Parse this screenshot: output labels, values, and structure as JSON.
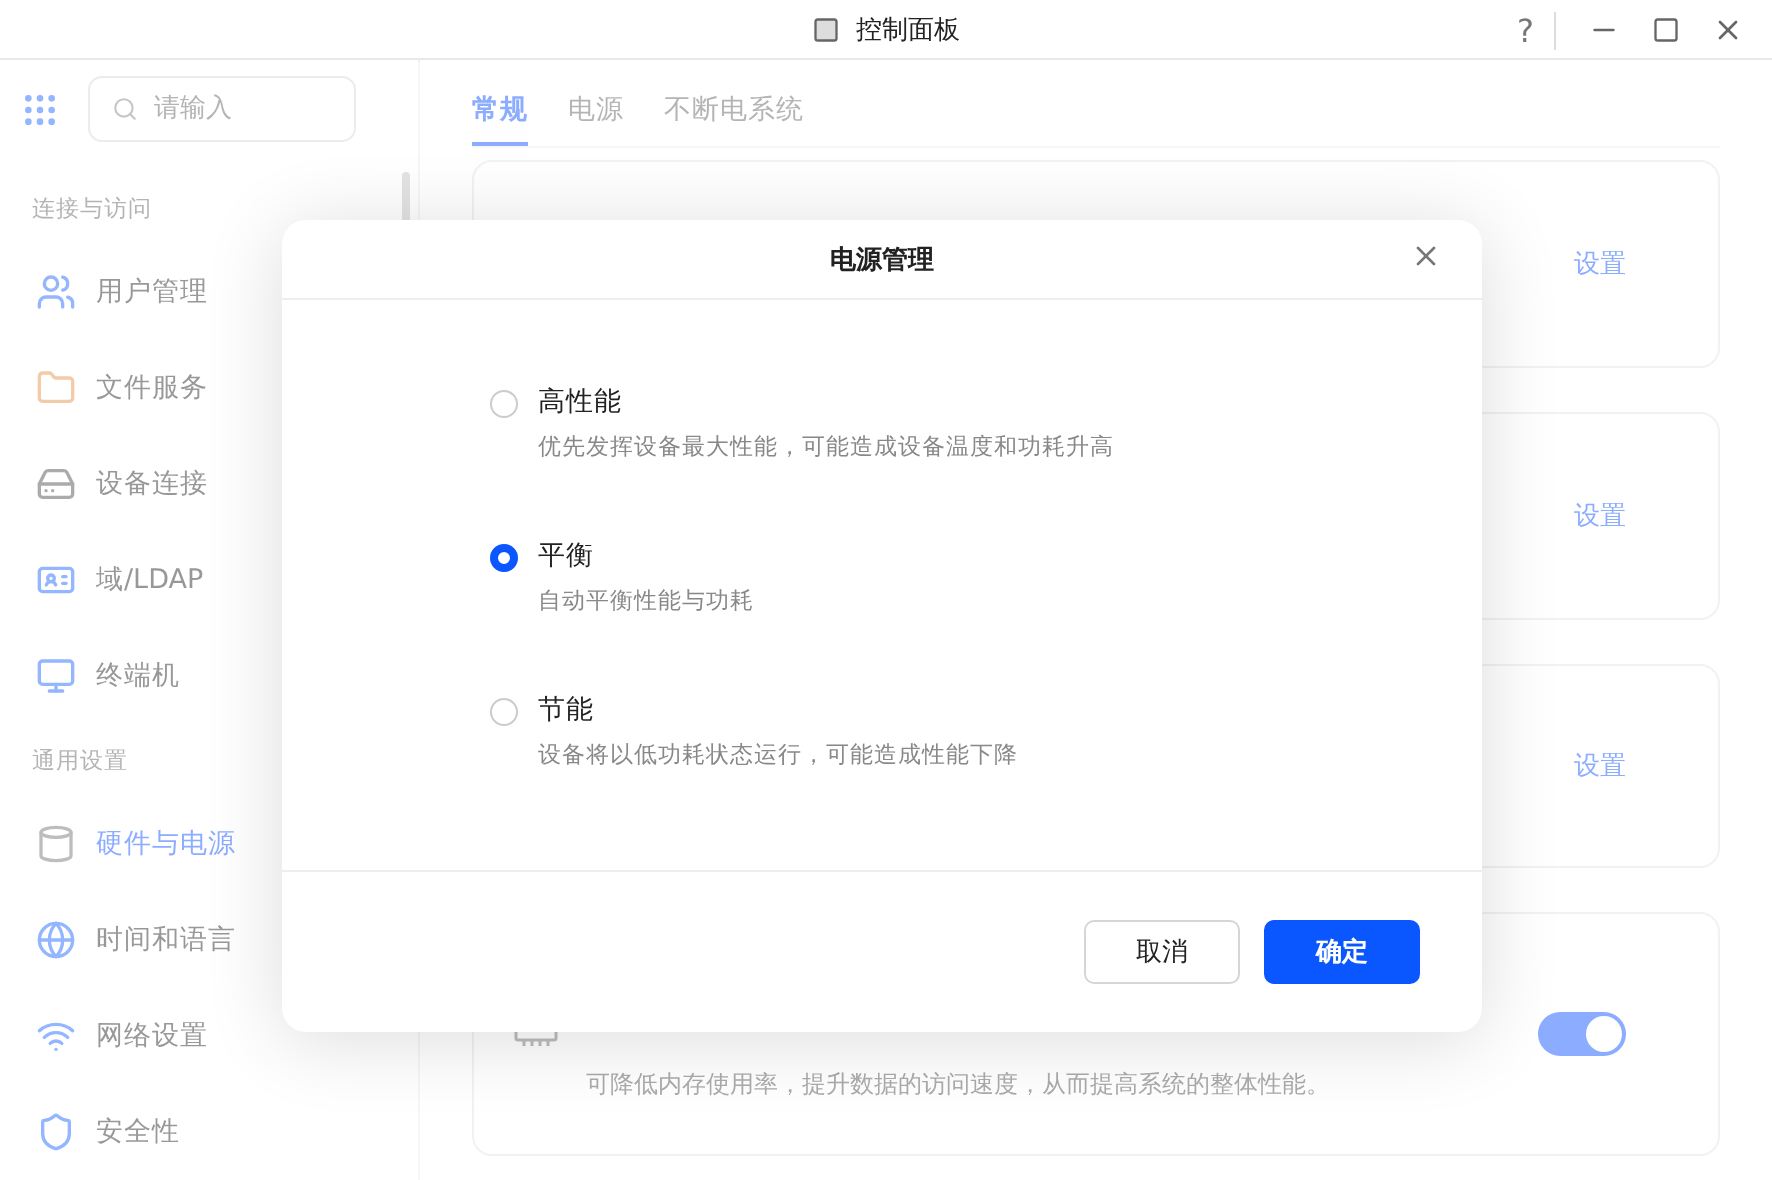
{
  "window": {
    "title": "控制面板",
    "buttons": [
      "?"
    ]
  },
  "sidebar": {
    "search": {
      "placeholder": "请输入"
    },
    "sections": [
      {
        "title": "连接与访问",
        "items": [
          {
            "label": "用户管理",
            "selected": false
          },
          {
            "label": "文件服务",
            "selected": false
          },
          {
            "label": "设备连接",
            "selected": false
          },
          {
            "label": "域/LDAP",
            "selected": false
          },
          {
            "label": "终端机",
            "selected": false
          }
        ]
      },
      {
        "title": "通用设置",
        "items": [
          {
            "label": "硬件与电源",
            "selected": true
          },
          {
            "label": "时间和语言",
            "selected": false
          },
          {
            "label": "网络设置",
            "selected": false
          },
          {
            "label": "安全性",
            "selected": false
          }
        ]
      }
    ]
  },
  "tabs": [
    {
      "label": "常规",
      "selected": true
    },
    {
      "label": "电源",
      "selected": false
    },
    {
      "label": "不断电系统",
      "selected": false
    }
  ],
  "cards": [
    {
      "link": "设置"
    },
    {
      "link": "设置"
    },
    {
      "link": "设置"
    },
    {
      "kind": "toggle",
      "on": true,
      "description": "可降低内存使用率，提升数据的访问速度，从而提高系统的整体性能。"
    }
  ],
  "dialog": {
    "title": "电源管理",
    "options": [
      {
        "label": "高性能",
        "description": "优先发挥设备最大性能，可能造成设备温度和功耗升高",
        "selected": false
      },
      {
        "label": "平衡",
        "description": "自动平衡性能与功耗",
        "selected": true
      },
      {
        "label": "节能",
        "description": "设备将以低功耗状态运行，可能造成性能下降",
        "selected": false
      }
    ],
    "buttons": [
      {
        "label": "取消",
        "kind": "secondary"
      },
      {
        "label": "确定",
        "kind": "primary"
      }
    ]
  }
}
